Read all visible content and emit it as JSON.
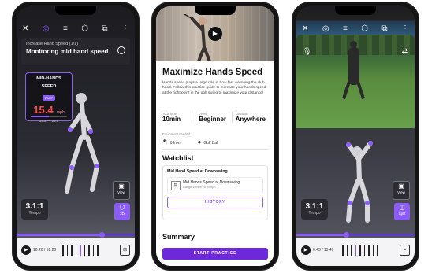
{
  "colors": {
    "accent": "#8b5cf6",
    "metric_value": "#ff4b4b",
    "start_button": "#6d28d9"
  },
  "phone1": {
    "topbar": {
      "close_icon": "close-icon",
      "tab_icons": [
        "target-icon",
        "lines-icon",
        "cube-icon",
        "layers-icon"
      ],
      "more_icon": "more-icon"
    },
    "card": {
      "subtitle": "Increase Hand Speed (1/1)",
      "title": "Monitoring mid hand speed"
    },
    "metric": {
      "label_line1": "MID-HANDS",
      "label_line2": "SPEED",
      "badge": "FAST",
      "value": "15.4",
      "unit": "mph",
      "range": "19.6 — 23.6",
      "progress": 0.5
    },
    "tempo": {
      "value": "3.1:1",
      "label": "Tempo"
    },
    "side_buttons": [
      {
        "label": "View",
        "icon": "camera-view-icon"
      },
      {
        "label": "3D",
        "icon": "cube-3d-icon"
      }
    ],
    "scrubber": {
      "progress": 0.72
    },
    "controls": {
      "time": "10:20 / 18:20"
    }
  },
  "phone2": {
    "title": "Maximize Hands Speed",
    "description": "Hands speed plays a large role in how fast we swing the club head. Follow this practice guide to increase your hands speed at the right point in the golf swing to maximize your distance!",
    "stats": [
      {
        "key": "Total time",
        "value": "10min"
      },
      {
        "key": "Level",
        "value": "Beginner"
      },
      {
        "key": "Location",
        "value": "Anywhere"
      }
    ],
    "equipment_label": "Equipment needed",
    "equipment": [
      {
        "icon": "club-icon",
        "label": "6 Iron"
      },
      {
        "icon": "golf-ball-icon",
        "label": "Golf Ball"
      }
    ],
    "watchlist": {
      "heading": "Watchlist",
      "card_title": "Mid Hand Speed at Downswing",
      "item_title": "Mid Hands Speed at Downswing",
      "item_sub": "Range 15mph To 30mph",
      "history_label": "HISTORY"
    },
    "summary_heading": "Summary",
    "start_label": "START PRACTICE"
  },
  "phone3": {
    "topbar": {
      "close_icon": "close-icon",
      "tab_icons": [
        "target-icon",
        "lines-icon",
        "cube-icon",
        "layers-icon"
      ],
      "more_icon": "more-icon",
      "mic_icon": "mic-icon",
      "flip_icon": "flip-icon"
    },
    "tempo": {
      "value": "3.1:1",
      "label": "Tempo"
    },
    "side_buttons": [
      {
        "label": "View",
        "icon": "camera-view-icon"
      },
      {
        "label": "Split",
        "icon": "split-icon"
      }
    ],
    "scrubber": {
      "progress": 0.42
    },
    "controls": {
      "time": "0:43 / 15:49"
    }
  }
}
